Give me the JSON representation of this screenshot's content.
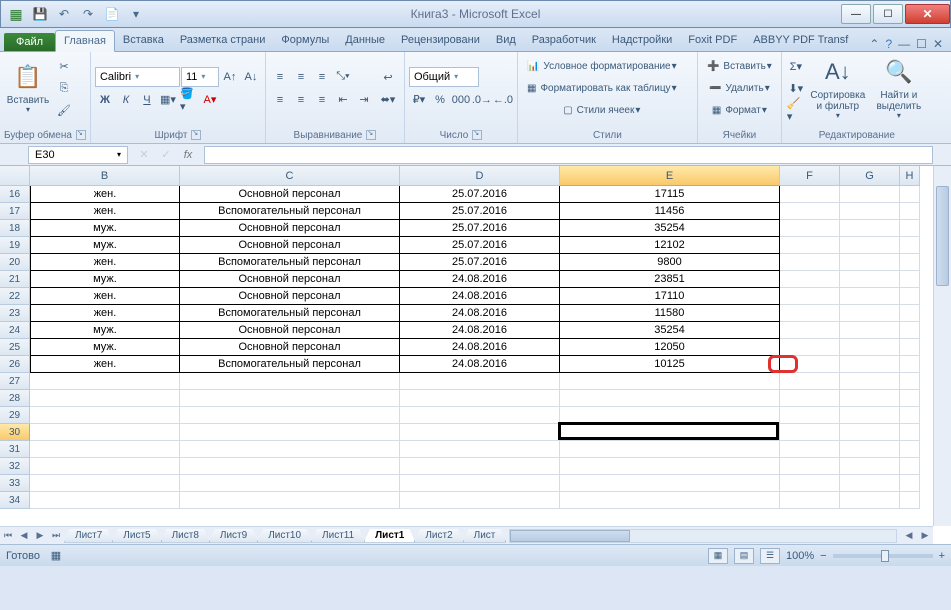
{
  "title": "Книга3  -  Microsoft Excel",
  "qat": {
    "save": "💾",
    "undo": "↶",
    "redo": "↷",
    "new": "📄",
    "more": "▾"
  },
  "win": {
    "min": "—",
    "max": "☐",
    "close": "✕"
  },
  "filetab": "Файл",
  "tabs": [
    "Главная",
    "Вставка",
    "Разметка страни",
    "Формулы",
    "Данные",
    "Рецензировани",
    "Вид",
    "Разработчик",
    "Надстройки",
    "Foxit PDF",
    "ABBYY PDF Transf"
  ],
  "ribbon": {
    "clipboard": {
      "paste": "Вставить",
      "label": "Буфер обмена"
    },
    "font": {
      "name": "Calibri",
      "size": "11",
      "label": "Шрифт",
      "bold": "Ж",
      "italic": "К",
      "underline": "Ч"
    },
    "align": {
      "label": "Выравнивание"
    },
    "number": {
      "format": "Общий",
      "label": "Число"
    },
    "styles": {
      "cond": "Условное форматирование",
      "table": "Форматировать как таблицу",
      "cell": "Стили ячеек",
      "label": "Стили"
    },
    "cells": {
      "insert": "Вставить",
      "delete": "Удалить",
      "format": "Формат",
      "label": "Ячейки"
    },
    "editing": {
      "sort": "Сортировка и фильтр",
      "find": "Найти и выделить",
      "label": "Редактирование"
    }
  },
  "namebox": "E30",
  "formula": "",
  "colwidths": {
    "B": 150,
    "C": 220,
    "D": 160,
    "E": 220,
    "F": 60,
    "G": 60,
    "H": 20
  },
  "cols": [
    "B",
    "C",
    "D",
    "E",
    "F",
    "G",
    "H"
  ],
  "rows_start": 16,
  "rows_end": 34,
  "selected_cell": {
    "row": 30,
    "col_index": 3
  },
  "selected_col": "E",
  "table": {
    "16": [
      "жен.",
      "Основной персонал",
      "25.07.2016",
      "17115"
    ],
    "17": [
      "жен.",
      "Вспомогательный персонал",
      "25.07.2016",
      "11456"
    ],
    "18": [
      "муж.",
      "Основной персонал",
      "25.07.2016",
      "35254"
    ],
    "19": [
      "муж.",
      "Основной персонал",
      "25.07.2016",
      "12102"
    ],
    "20": [
      "жен.",
      "Вспомогательный персонал",
      "25.07.2016",
      "9800"
    ],
    "21": [
      "муж.",
      "Основной персонал",
      "24.08.2016",
      "23851"
    ],
    "22": [
      "жен.",
      "Основной персонал",
      "24.08.2016",
      "17110"
    ],
    "23": [
      "жен.",
      "Вспомогательный персонал",
      "24.08.2016",
      "11580"
    ],
    "24": [
      "муж.",
      "Основной персонал",
      "24.08.2016",
      "35254"
    ],
    "25": [
      "муж.",
      "Основной персонал",
      "24.08.2016",
      "12050"
    ],
    "26": [
      "жен.",
      "Вспомогательный персонал",
      "24.08.2016",
      "10125"
    ]
  },
  "sheets": [
    "Лист7",
    "Лист5",
    "Лист8",
    "Лист9",
    "Лист10",
    "Лист11",
    "Лист1",
    "Лист2",
    "Лист"
  ],
  "active_sheet": "Лист1",
  "status": "Готово",
  "zoom": "100%"
}
